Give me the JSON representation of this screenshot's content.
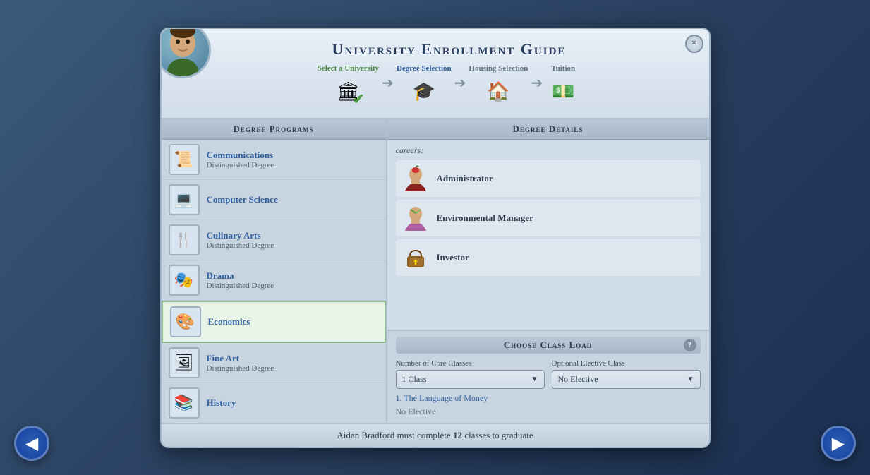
{
  "title": "University Enrollment Guide",
  "close_label": "×",
  "steps": [
    {
      "id": "select-university",
      "label": "Select a University",
      "icon": "🏛",
      "done": true,
      "active": false
    },
    {
      "id": "degree-selection",
      "label": "Degree Selection",
      "icon": "🎓",
      "done": false,
      "active": true
    },
    {
      "id": "housing-selection",
      "label": "Housing Selection",
      "icon": "🏠",
      "done": false,
      "active": false
    },
    {
      "id": "tuition",
      "label": "Tuition",
      "icon": "💵",
      "done": false,
      "active": false
    }
  ],
  "panels": {
    "left_header": "Degree Programs",
    "right_header": "Degree Details"
  },
  "degrees": [
    {
      "id": "communications",
      "name": "Communications",
      "tag": "Distinguished Degree",
      "icon": "📜",
      "selected": false
    },
    {
      "id": "computer-science",
      "name": "Computer Science",
      "tag": "",
      "icon": "💻",
      "selected": false
    },
    {
      "id": "culinary-arts",
      "name": "Culinary Arts",
      "tag": "Distinguished Degree",
      "icon": "🍴",
      "selected": false
    },
    {
      "id": "drama",
      "name": "Drama",
      "tag": "Distinguished Degree",
      "icon": "🎭",
      "selected": false
    },
    {
      "id": "economics",
      "name": "Economics",
      "tag": "",
      "icon": "🎨",
      "selected": true
    },
    {
      "id": "fine-art",
      "name": "Fine Art",
      "tag": "Distinguished Degree",
      "icon": "🖼",
      "selected": false
    },
    {
      "id": "history",
      "name": "History",
      "tag": "",
      "icon": "📚",
      "selected": false
    }
  ],
  "careers_label": "careers:",
  "careers": [
    {
      "id": "administrator",
      "name": "Administrator",
      "icon": "🍎"
    },
    {
      "id": "environmental-manager",
      "name": "Environmental Manager",
      "icon": "🌱"
    },
    {
      "id": "investor",
      "name": "Investor",
      "icon": "💼"
    }
  ],
  "class_load": {
    "title": "Choose Class Load",
    "help": "?",
    "core_label": "Number of Core Classes",
    "core_value": "1 Class",
    "elective_label": "Optional Elective Class",
    "elective_value": "No Elective",
    "class_list": [
      {
        "number": "1.",
        "name": "The Language of Money"
      }
    ],
    "no_elective": "No Elective"
  },
  "footer": {
    "text_before": "Aidan Bradford must complete ",
    "count": "12",
    "text_after": " classes to graduate"
  },
  "nav": {
    "prev": "◀",
    "next": "▶"
  }
}
